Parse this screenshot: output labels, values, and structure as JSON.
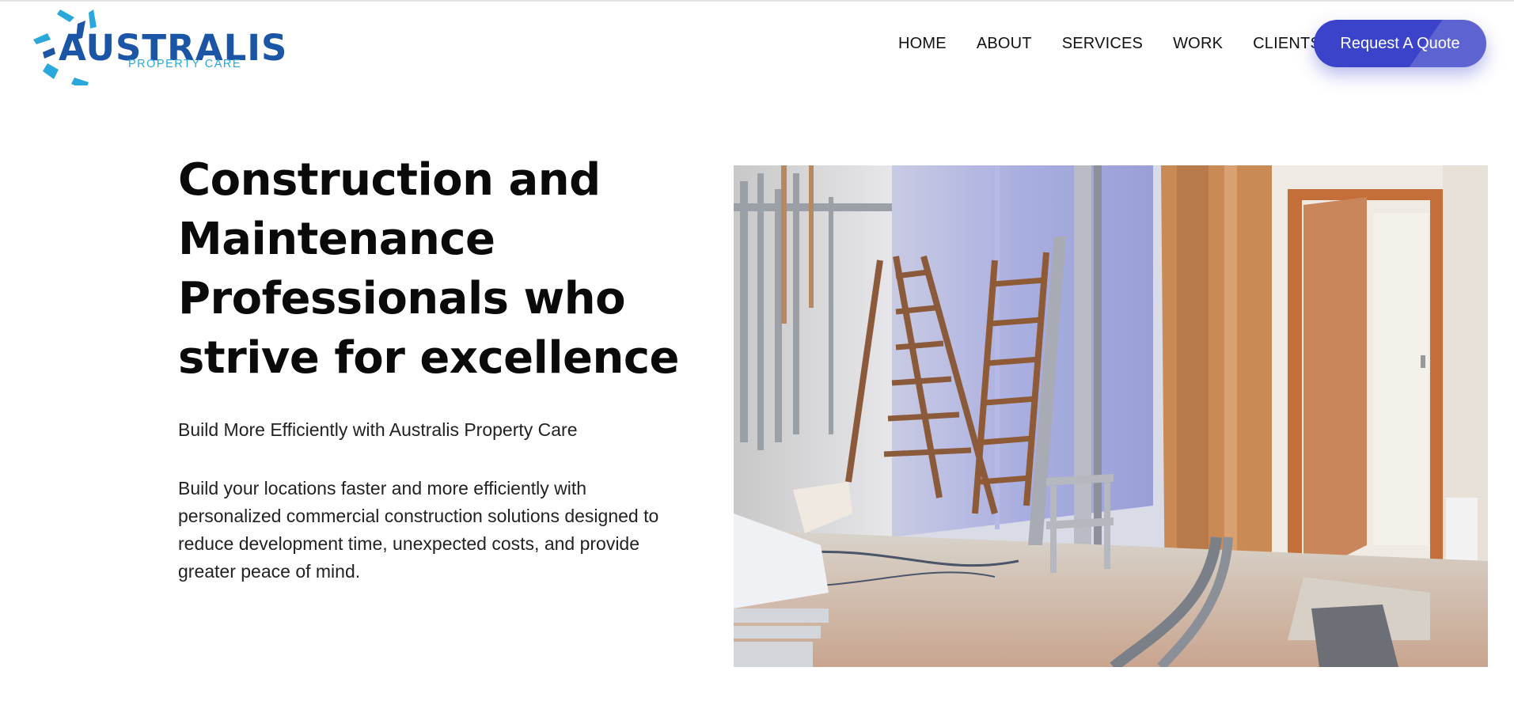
{
  "brand": {
    "name": "AUSTRALIS",
    "tagline": "PROPERTY CARE",
    "colors": {
      "primary": "#1b55a5",
      "accent": "#2aa8dc"
    }
  },
  "nav": {
    "items": [
      {
        "label": "HOME"
      },
      {
        "label": "ABOUT"
      },
      {
        "label": "SERVICES"
      },
      {
        "label": "WORK"
      },
      {
        "label": "CLIENTS"
      }
    ],
    "cta_label": "Request A Quote",
    "cta_color": "#3a43c9"
  },
  "hero": {
    "title_lines": [
      "Construction and",
      "Maintenance",
      "Professionals who",
      "strive for excellence"
    ],
    "subtitle": "Build More Efficiently with Australis Property Care",
    "body_lines": [
      "Build your locations faster and more efficiently with",
      "personalized commercial construction solutions designed to",
      "reduce development time, unexpected costs, and provide",
      "greater peace of mind."
    ],
    "image_icon": "construction-site-photo"
  }
}
